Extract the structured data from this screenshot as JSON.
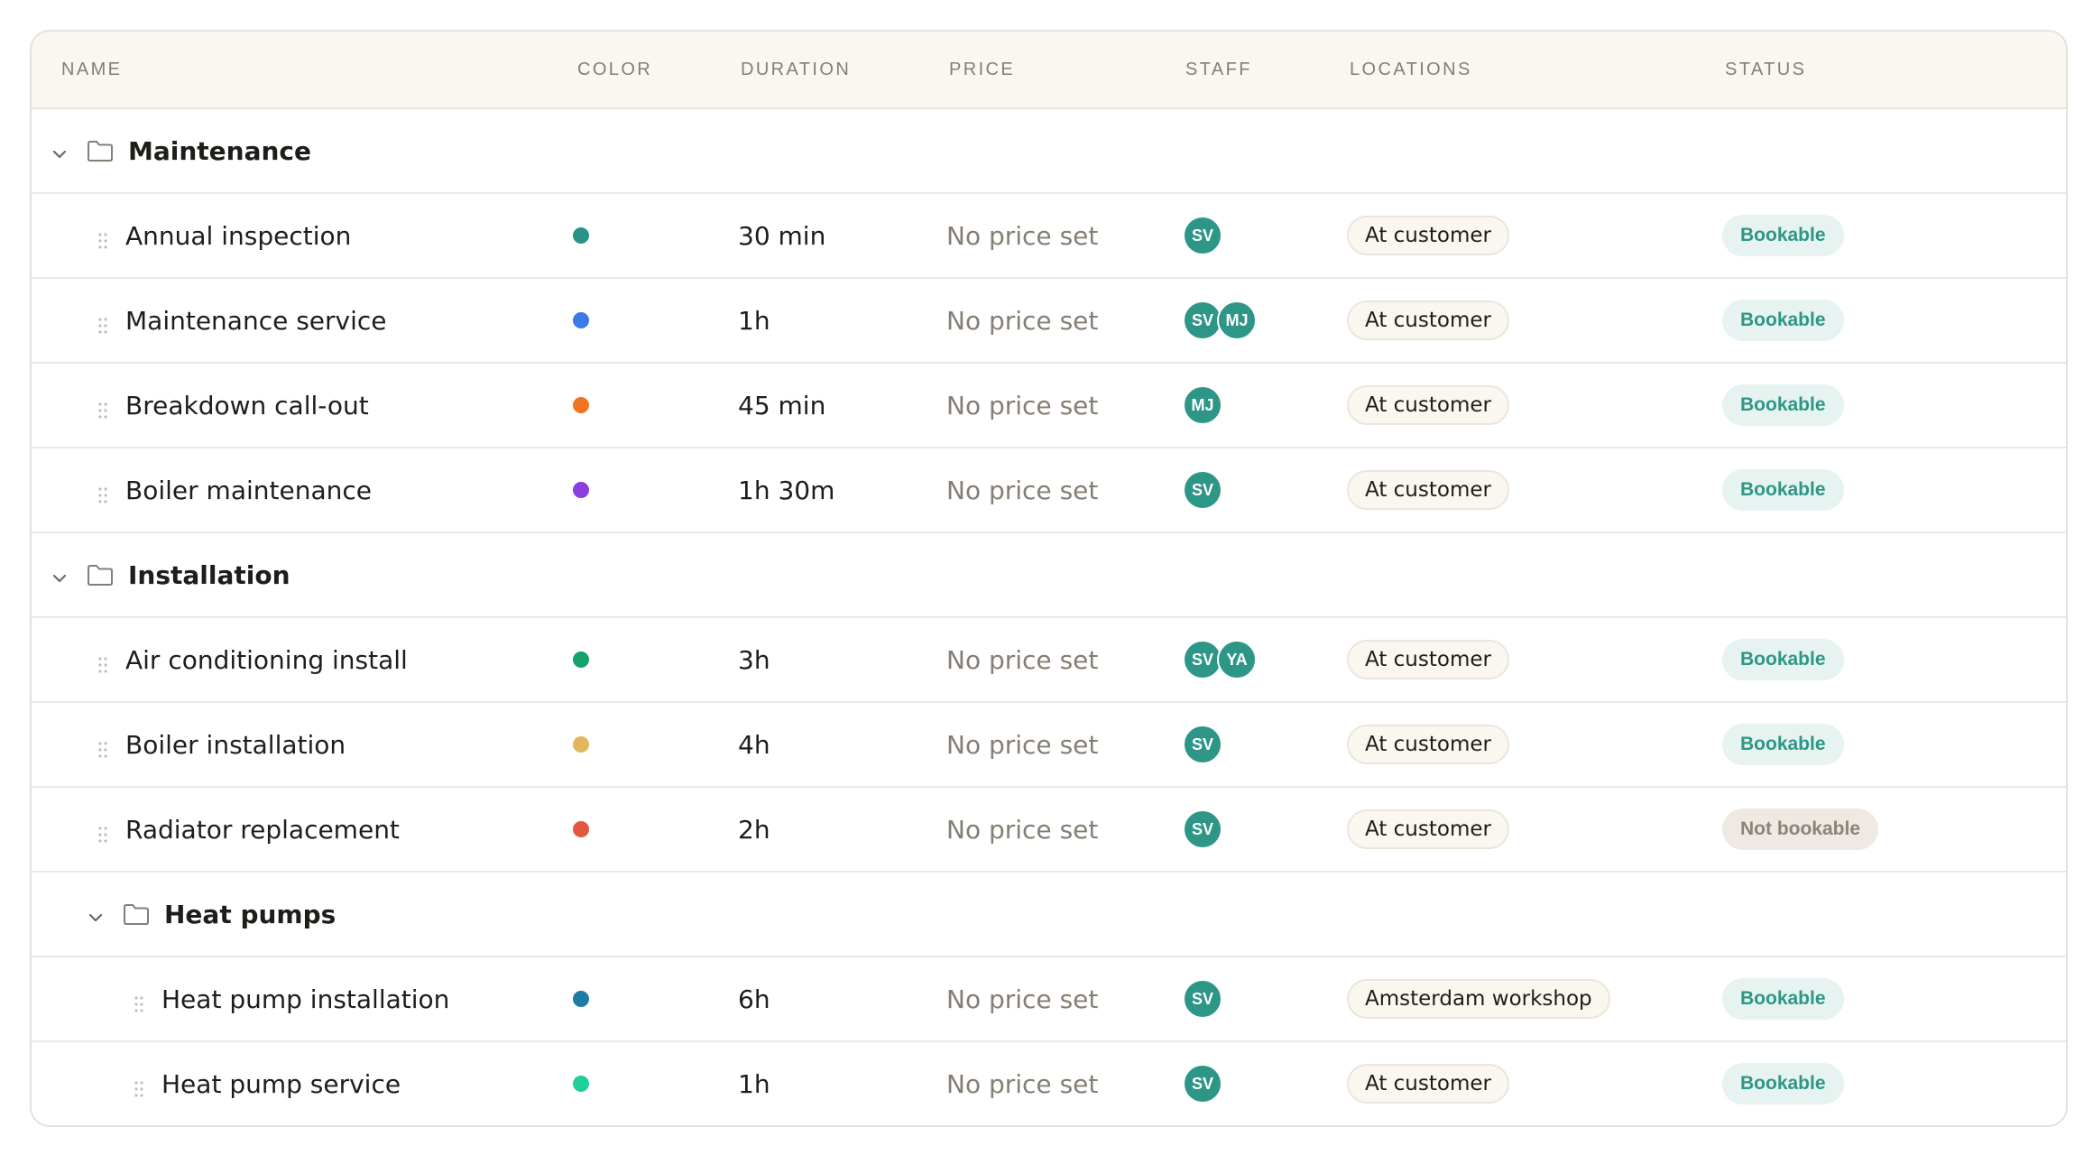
{
  "headers": {
    "name": "NAME",
    "color": "COLOR",
    "duration": "DURATION",
    "price": "PRICE",
    "staff": "STAFF",
    "locations": "LOCATIONS",
    "status": "STATUS"
  },
  "rows": [
    {
      "type": "group",
      "level": 0,
      "title": "Maintenance"
    },
    {
      "type": "service",
      "level": 0,
      "name": "Annual inspection",
      "color": "#2a9287",
      "duration": "30 min",
      "price": "No price set",
      "staff": [
        "SV"
      ],
      "location": "At customer",
      "status": "Bookable",
      "bookable": true
    },
    {
      "type": "service",
      "level": 0,
      "name": "Maintenance service",
      "color": "#3b7be8",
      "duration": "1h",
      "price": "No price set",
      "staff": [
        "SV",
        "MJ"
      ],
      "location": "At customer",
      "status": "Bookable",
      "bookable": true
    },
    {
      "type": "service",
      "level": 0,
      "name": "Breakdown call-out",
      "color": "#f2731f",
      "duration": "45 min",
      "price": "No price set",
      "staff": [
        "MJ"
      ],
      "location": "At customer",
      "status": "Bookable",
      "bookable": true
    },
    {
      "type": "service",
      "level": 0,
      "name": "Boiler maintenance",
      "color": "#8a3ee0",
      "duration": "1h 30m",
      "price": "No price set",
      "staff": [
        "SV"
      ],
      "location": "At customer",
      "status": "Bookable",
      "bookable": true
    },
    {
      "type": "group",
      "level": 0,
      "title": "Installation"
    },
    {
      "type": "service",
      "level": 0,
      "name": "Air conditioning install",
      "color": "#16a36b",
      "duration": "3h",
      "price": "No price set",
      "staff": [
        "SV",
        "YA"
      ],
      "location": "At customer",
      "status": "Bookable",
      "bookable": true
    },
    {
      "type": "service",
      "level": 0,
      "name": "Boiler installation",
      "color": "#e2b75c",
      "duration": "4h",
      "price": "No price set",
      "staff": [
        "SV"
      ],
      "location": "At customer",
      "status": "Bookable",
      "bookable": true
    },
    {
      "type": "service",
      "level": 0,
      "name": "Radiator replacement",
      "color": "#e4573f",
      "duration": "2h",
      "price": "No price set",
      "staff": [
        "SV"
      ],
      "location": "At customer",
      "status": "Not bookable",
      "bookable": false
    },
    {
      "type": "group",
      "level": 1,
      "title": "Heat pumps"
    },
    {
      "type": "service",
      "level": 1,
      "name": "Heat pump installation",
      "color": "#1f7aa5",
      "duration": "6h",
      "price": "No price set",
      "staff": [
        "SV"
      ],
      "location": "Amsterdam workshop",
      "status": "Bookable",
      "bookable": true
    },
    {
      "type": "service",
      "level": 1,
      "name": "Heat pump service",
      "color": "#1fcf9c",
      "duration": "1h",
      "price": "No price set",
      "staff": [
        "SV"
      ],
      "location": "At customer",
      "status": "Bookable",
      "bookable": true
    }
  ]
}
